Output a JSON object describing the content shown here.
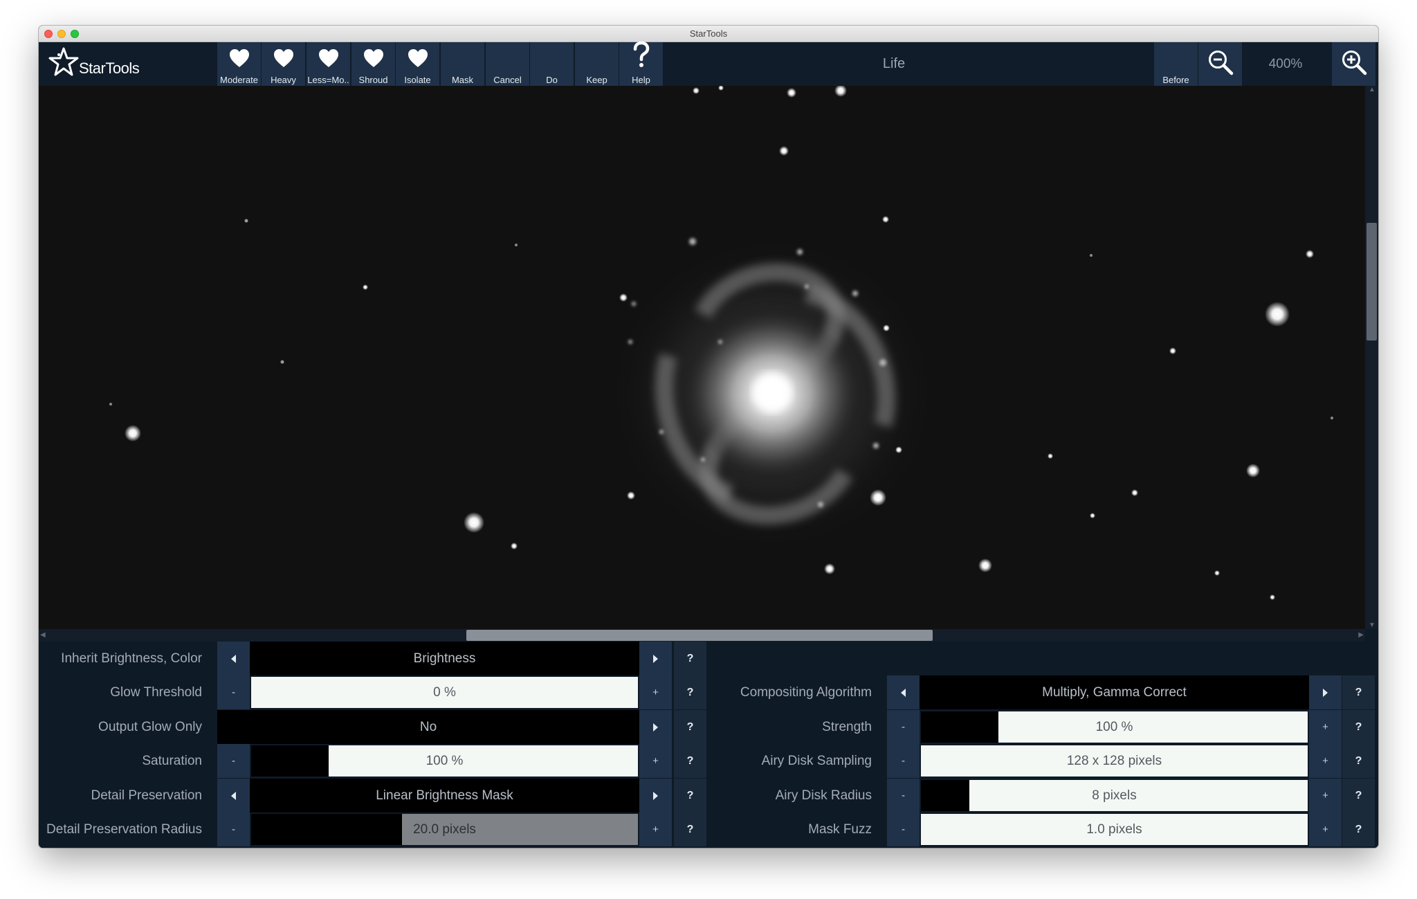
{
  "window": {
    "title": "StarTools"
  },
  "app": {
    "logo_text": "StarTools"
  },
  "toolbar": {
    "presets": [
      {
        "label": "Moderate",
        "icon": "heart-icon"
      },
      {
        "label": "Heavy",
        "icon": "heart-icon"
      },
      {
        "label": "Less=Mo..",
        "icon": "heart-icon"
      },
      {
        "label": "Shroud",
        "icon": "heart-icon"
      },
      {
        "label": "Isolate",
        "icon": "heart-icon"
      }
    ],
    "actions": [
      {
        "label": "Mask"
      },
      {
        "label": "Cancel"
      },
      {
        "label": "Do"
      },
      {
        "label": "Keep"
      },
      {
        "label": "Help",
        "icon": "question-icon"
      }
    ],
    "module_title": "Life",
    "before_label": "Before",
    "zoom_level": "400%",
    "zoom_out_icon": "zoom-out-icon",
    "zoom_in_icon": "zoom-in-icon"
  },
  "params_left": [
    {
      "label": "Inherit Brightness, Color",
      "type": "select",
      "value": "Brightness",
      "minus": "",
      "plus": "",
      "help": "?"
    },
    {
      "label": "Glow Threshold",
      "type": "slider",
      "value": "0 %",
      "fill": 0.0,
      "minus": "-",
      "plus": "+",
      "help": "?"
    },
    {
      "label": "Output Glow Only",
      "type": "select-nominus",
      "value": "No",
      "plus": "",
      "help": "?"
    },
    {
      "label": "Saturation",
      "type": "slider",
      "value": "100 %",
      "fill": 0.2,
      "minus": "-",
      "plus": "+",
      "help": "?"
    },
    {
      "label": "Detail Preservation",
      "type": "select",
      "value": "Linear Brightness Mask",
      "minus": "",
      "plus": "",
      "help": "?"
    },
    {
      "label": "Detail Preservation Radius",
      "type": "slider-grey",
      "value": "20.0 pixels",
      "fill": 0.39,
      "minus": "-",
      "plus": "+",
      "help": "?"
    }
  ],
  "params_right": [
    {
      "label": "Compositing Algorithm",
      "type": "select",
      "value": "Multiply, Gamma Correct",
      "minus": "",
      "plus": "",
      "help": "?"
    },
    {
      "label": "Strength",
      "type": "slider",
      "value": "100 %",
      "fill": 0.2,
      "minus": "-",
      "plus": "+",
      "help": "?"
    },
    {
      "label": "Airy Disk Sampling",
      "type": "slider",
      "value": "128 x 128 pixels",
      "fill": 0.0,
      "minus": "-",
      "plus": "+",
      "help": "?"
    },
    {
      "label": "Airy Disk Radius",
      "type": "slider",
      "value": "8 pixels",
      "fill": 0.125,
      "minus": "-",
      "plus": "+",
      "help": "?"
    },
    {
      "label": "Mask Fuzz",
      "type": "slider",
      "value": "1.0 pixels",
      "fill": 0.0,
      "minus": "-",
      "plus": "+",
      "help": "?"
    }
  ],
  "colors": {
    "toolbar_bg": "#101c2a",
    "button_bg": "#1f3249",
    "slider_bg": "#f4f8f5",
    "panel_bg": "#0f1a27"
  }
}
